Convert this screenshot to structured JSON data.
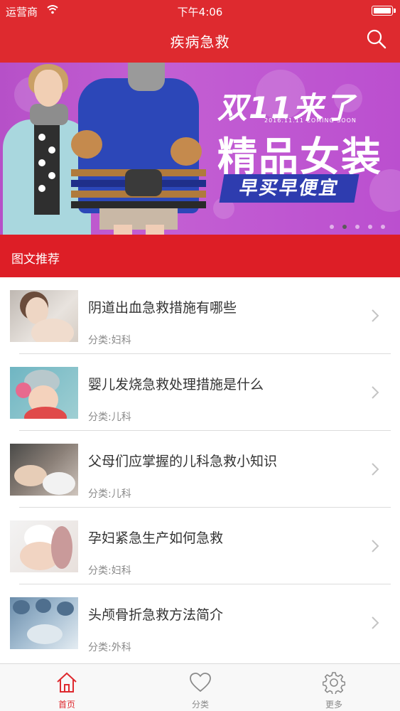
{
  "status_bar": {
    "carrier": "运营商",
    "time": "下午4:06"
  },
  "nav": {
    "title": "疾病急救"
  },
  "banner": {
    "line1": "双11来了",
    "date": "2016.11.11 COMING SOON",
    "line2": "精品女装",
    "tag": "早买早便宜",
    "pages": 5,
    "active_page": 2
  },
  "section": {
    "title": "图文推荐"
  },
  "articles": [
    {
      "title": "阴道出血急救措施有哪些",
      "category": "分类:妇科"
    },
    {
      "title": "婴儿发烧急救处理措施是什么",
      "category": "分类:儿科"
    },
    {
      "title": "父母们应掌握的儿科急救小知识",
      "category": "分类:儿科"
    },
    {
      "title": "孕妇紧急生产如何急救",
      "category": "分类:妇科"
    },
    {
      "title": "头颅骨折急救方法简介",
      "category": "分类:外科"
    }
  ],
  "tabs": [
    {
      "label": "首页",
      "icon": "home-icon",
      "active": true
    },
    {
      "label": "分类",
      "icon": "heart-icon",
      "active": false
    },
    {
      "label": "更多",
      "icon": "gear-icon",
      "active": false
    }
  ],
  "colors": {
    "primary_red": "#de2a2f",
    "section_red": "#dd1e26",
    "banner_purple": "#c35fd3"
  }
}
